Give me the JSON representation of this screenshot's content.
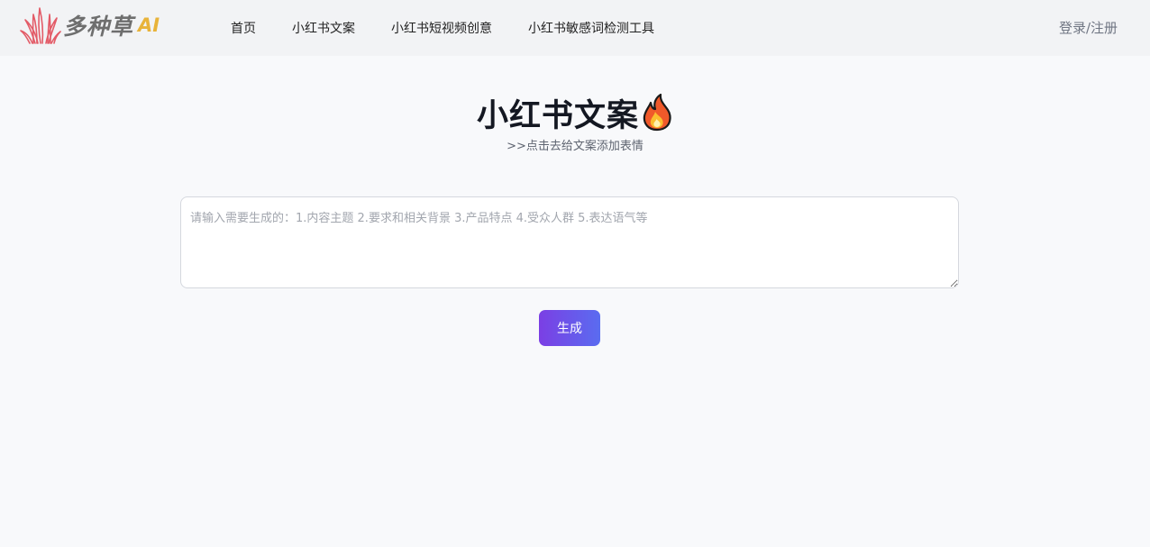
{
  "header": {
    "logo_text": "多种草",
    "logo_ai": "AI",
    "nav": [
      {
        "label": "首页"
      },
      {
        "label": "小红书文案"
      },
      {
        "label": "小红书短视频创意"
      },
      {
        "label": "小红书敏感词检测工具"
      }
    ],
    "login_label": "登录/注册"
  },
  "main": {
    "title": "小红书文案",
    "title_icon": "fire-icon",
    "subtitle": ">>点击去给文案添加表情",
    "prompt": {
      "value": "",
      "placeholder": "请输入需要生成的：1.内容主题 2.要求和相关背景 3.产品特点 4.受众人群 5.表达语气等"
    },
    "generate_label": "生成"
  },
  "colors": {
    "logo_grass": "#e35b67",
    "logo_ai": "#e8b33a",
    "button_gradient_start": "#7b3fe4",
    "button_gradient_end": "#5a6cf0"
  }
}
